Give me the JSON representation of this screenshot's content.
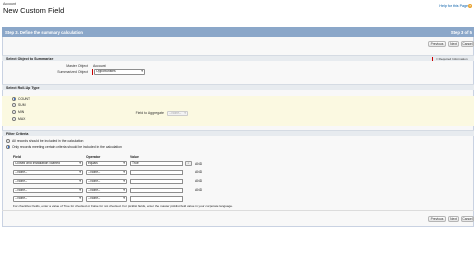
{
  "header": {
    "entity_label": "Account",
    "page_title": "New Custom Field",
    "help_link": "Help for this Page",
    "help_icon": "question-icon"
  },
  "step": {
    "title": "Step 3. Define the summary calculation",
    "of": "Step 3 of 5"
  },
  "buttons": {
    "previous": "Previous",
    "next": "Next",
    "cancel": "Cancel"
  },
  "summarize_section": {
    "title": "Select Object to Summarize",
    "required_info": "= Required Information",
    "master_object_label": "Master Object",
    "master_object_value": "Account",
    "summarized_object_label": "Summarized Object",
    "summarized_object_value": "Opportunities"
  },
  "rollup_section": {
    "title": "Select Roll-Up Type",
    "options": [
      "COUNT",
      "SUM",
      "MIN",
      "MAX"
    ],
    "selected": "COUNT",
    "field_to_aggregate_label": "Field to Aggregate",
    "field_to_aggregate_value": "--None--"
  },
  "filter_section": {
    "title": "Filter Criteria",
    "option_all": "All records should be included in the calculation",
    "option_some": "Only records meeting certain criteria should be included in the calculation",
    "col_field": "Field",
    "col_operator": "Operator",
    "col_value": "Value",
    "rows": [
      {
        "field": "Closed and Installation Started",
        "operator": "equals",
        "value": "True",
        "connector": "AND"
      },
      {
        "field": "--None--",
        "operator": "--None--",
        "value": "",
        "connector": "AND"
      },
      {
        "field": "--None--",
        "operator": "--None--",
        "value": "",
        "connector": "AND"
      },
      {
        "field": "--None--",
        "operator": "--None--",
        "value": "",
        "connector": "AND"
      },
      {
        "field": "--None--",
        "operator": "--None--",
        "value": "",
        "connector": ""
      }
    ],
    "note": "For checkbox fields, enter a value of True for checked or False for not checked. For picklist fields, enter the master picklist field value in your corporate language."
  },
  "colors": {
    "step_header": "#8ba7c9",
    "section_band": "#e7ebef",
    "rollup_band": "#fbf9e1",
    "required": "#cc0000",
    "link": "#015ba7"
  }
}
